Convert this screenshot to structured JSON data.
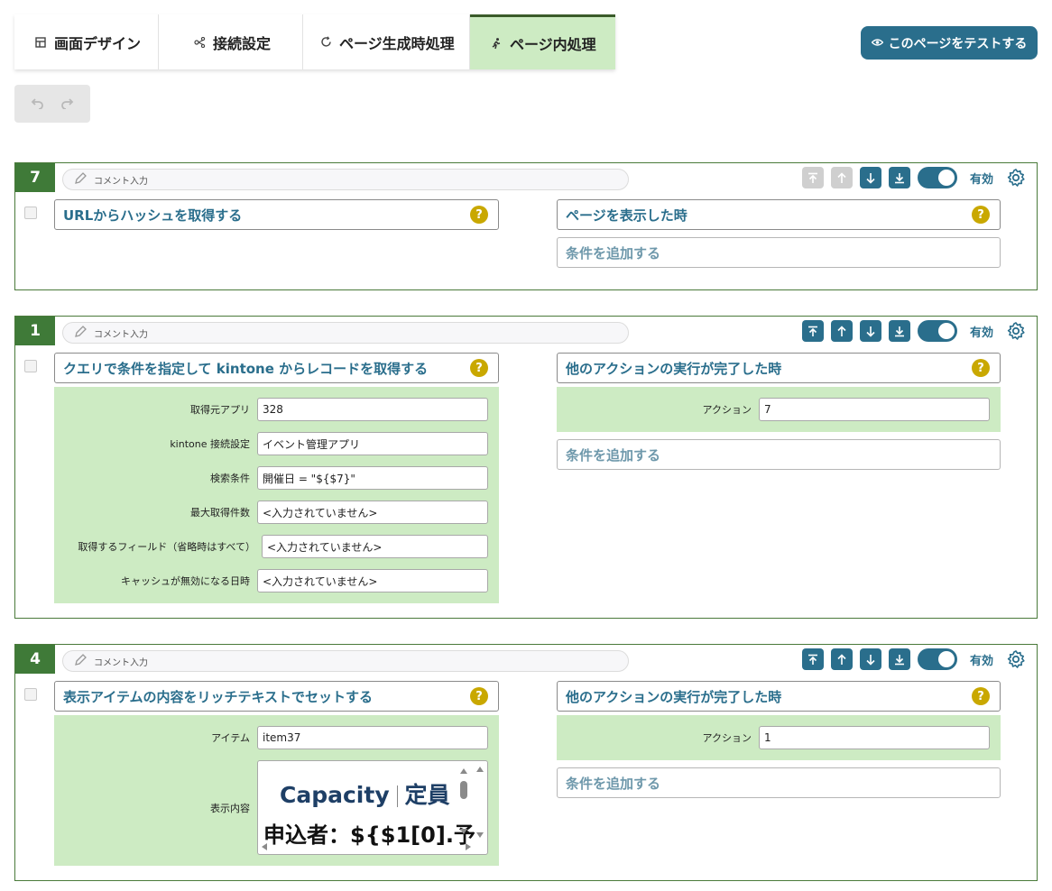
{
  "tabs": [
    {
      "label": "画面デザイン",
      "icon": "layout-icon",
      "active": false
    },
    {
      "label": "接続設定",
      "icon": "connection-icon",
      "active": false
    },
    {
      "label": "ページ生成時処理",
      "icon": "refresh-icon",
      "active": false
    },
    {
      "label": "ページ内処理",
      "icon": "running-person-icon",
      "active": true
    }
  ],
  "test_button": {
    "label": "このページをテストする",
    "icon": "eye-icon"
  },
  "undo_redo": {
    "undo_icon": "undo-icon",
    "redo_icon": "redo-icon"
  },
  "blocks": [
    {
      "number": "7",
      "comment_placeholder": "コメント入力",
      "enabled_label": "有効",
      "action_title": "URLからハッシュを取得する",
      "trigger_title": "ページを表示した時",
      "add_condition": "条件を追加する",
      "top_up_disabled": true
    },
    {
      "number": "1",
      "comment_placeholder": "コメント入力",
      "enabled_label": "有効",
      "action_title": "クエリで条件を指定して kintone からレコードを取得する",
      "params": [
        {
          "label": "取得元アプリ",
          "value": "328"
        },
        {
          "label": "kintone 接続設定",
          "value": "イベント管理アプリ"
        },
        {
          "label": "検索条件",
          "value": "開催日 = \"${$7}\""
        },
        {
          "label": "最大取得件数",
          "value": "<入力されていません>"
        },
        {
          "label": "取得するフィールド（省略時はすべて）",
          "value": "<入力されていません>"
        },
        {
          "label": "キャッシュが無効になる日時",
          "value": "<入力されていません>"
        }
      ],
      "trigger_title": "他のアクションの実行が完了した時",
      "trigger_params": [
        {
          "label": "アクション",
          "value": "7"
        }
      ],
      "add_condition": "条件を追加する"
    },
    {
      "number": "4",
      "comment_placeholder": "コメント入力",
      "enabled_label": "有効",
      "action_title": "表示アイテムの内容をリッチテキストでセットする",
      "params": [
        {
          "label": "アイテム",
          "value": "item37"
        },
        {
          "label": "表示内容",
          "value_line1_a": "Capacity",
          "value_line1_b": "定員",
          "value_line2": "申込者：${$1[0].予"
        }
      ],
      "trigger_title": "他のアクションの実行が完了した時",
      "trigger_params": [
        {
          "label": "アクション",
          "value": "1"
        }
      ],
      "add_condition": "条件を追加する"
    }
  ],
  "colors": {
    "accent": "#2a6e8c",
    "block_border": "#4a7a3a",
    "param_bg": "#cdebc3",
    "help": "#c9a800"
  }
}
